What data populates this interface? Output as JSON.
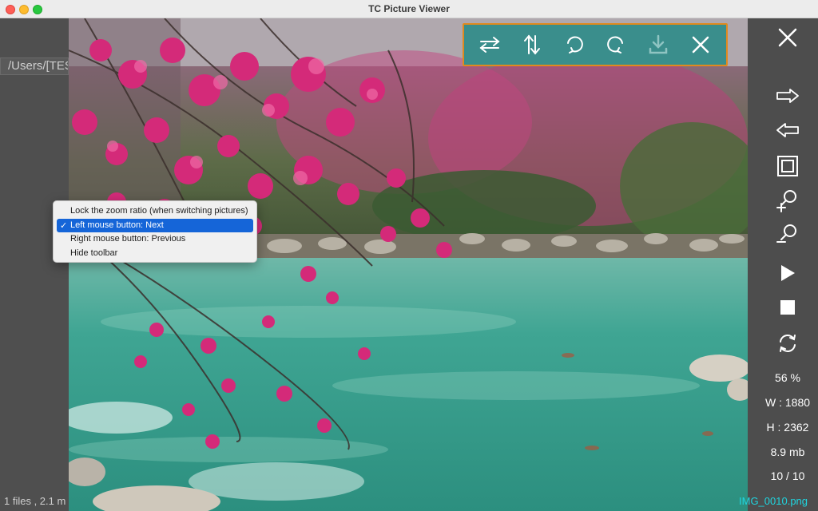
{
  "window": {
    "title": "TC Picture Viewer"
  },
  "background_pane": {
    "path_text": "/Users/[TES",
    "status_text": "1 files ,  2.1 m"
  },
  "toolbar": {
    "items": [
      {
        "name": "flip-horizontal",
        "icon": "flip-horizontal-icon"
      },
      {
        "name": "flip-vertical",
        "icon": "flip-vertical-icon"
      },
      {
        "name": "rotate-clockwise",
        "icon": "rotate-cw-icon"
      },
      {
        "name": "rotate-counterclockwise",
        "icon": "rotate-ccw-icon"
      },
      {
        "name": "save",
        "icon": "download-icon"
      },
      {
        "name": "close",
        "icon": "close-icon"
      }
    ],
    "color": "#3a8e8c",
    "border_color": "#e08a1e"
  },
  "context_menu": {
    "items": [
      {
        "label": "Lock the zoom ratio (when switching pictures)",
        "checked": false,
        "highlighted": false
      },
      {
        "label": "Left mouse button: Next",
        "checked": true,
        "highlighted": true
      },
      {
        "label": "Right mouse button: Previous",
        "checked": false,
        "highlighted": false
      },
      {
        "label": "Hide toolbar",
        "checked": false,
        "highlighted": false
      }
    ],
    "check_glyph": "✓"
  },
  "sidebar": {
    "buttons": [
      {
        "name": "close",
        "icon": "close-icon"
      },
      {
        "name": "next",
        "icon": "arrow-right-icon"
      },
      {
        "name": "previous",
        "icon": "arrow-left-icon"
      },
      {
        "name": "fit",
        "icon": "fit-window-icon"
      },
      {
        "name": "zoom-in",
        "icon": "zoom-in-icon"
      },
      {
        "name": "zoom-out",
        "icon": "zoom-out-icon"
      },
      {
        "name": "play",
        "icon": "play-icon"
      },
      {
        "name": "stop",
        "icon": "stop-icon"
      },
      {
        "name": "refresh",
        "icon": "refresh-icon"
      }
    ],
    "zoom": "56 %",
    "width": "W : 1880",
    "height": "H : 2362",
    "size": "8.9 mb",
    "position": "10 / 10",
    "filename": "IMG_0010.png"
  },
  "colors": {
    "menu_highlight": "#1565d8",
    "filename": "#1fd6e0"
  }
}
